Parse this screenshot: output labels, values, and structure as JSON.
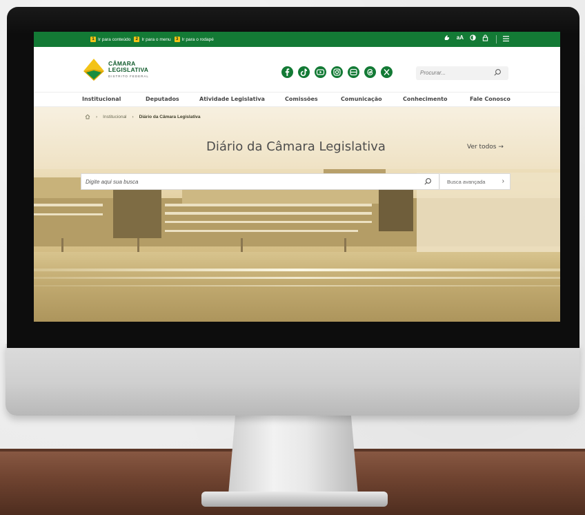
{
  "skip_links": [
    {
      "num": "1",
      "label": "Ir para conteúdo"
    },
    {
      "num": "2",
      "label": "Ir para o menu"
    },
    {
      "num": "3",
      "label": "Ir para o rodapé"
    }
  ],
  "tools": {
    "font_size_label": "aA"
  },
  "logo": {
    "line1": "CÂMARA",
    "line2": "LEGISLATIVA",
    "line3": "DISTRITO FEDERAL"
  },
  "socials": [
    "facebook-icon",
    "tiktok-icon",
    "youtube-icon",
    "instagram-icon",
    "flickr-icon",
    "threads-icon",
    "x-icon"
  ],
  "header_search": {
    "placeholder": "Procurar..."
  },
  "nav": {
    "items": [
      "Institucional",
      "Deputados",
      "Atividade Legislativa",
      "Comissões",
      "Comunicação",
      "Conhecimento",
      "Fale Conosco"
    ]
  },
  "breadcrumb": {
    "level1": "Institucional",
    "current": "Diário da Câmara Legislativa"
  },
  "hero": {
    "title": "Diário da Câmara Legislativa",
    "see_all": "Ver todos →",
    "search_placeholder": "Digite aqui sua busca",
    "advanced_search": "Busca avançada"
  },
  "colors": {
    "brand_green": "#137a35",
    "accent_yellow": "#f3c316"
  }
}
